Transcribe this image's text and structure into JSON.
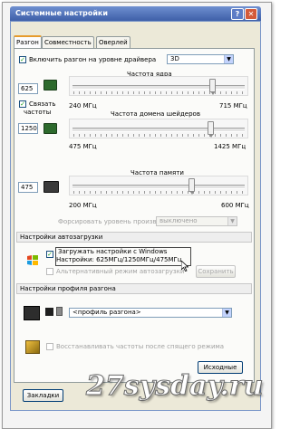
{
  "window": {
    "title": "Системные настройки"
  },
  "tabs": [
    {
      "label": "Разгон"
    },
    {
      "label": "Совместность"
    },
    {
      "label": "Оверлей"
    }
  ],
  "driver": {
    "enable_label": "Включить разгон на уровне драйвера",
    "enable_checked": true,
    "mode_value": "3D"
  },
  "core": {
    "title": "Частота ядра",
    "value": "625",
    "min_label": "240 МГц",
    "max_label": "715 МГц",
    "level": 0.81
  },
  "link": {
    "label_line1": "Связать",
    "label_line2": "частоты",
    "checked": true
  },
  "shader": {
    "title": "Частота домена шейдеров",
    "value": "1250",
    "min_label": "475 МГц",
    "max_label": "1425 МГц",
    "level": 0.8
  },
  "memory": {
    "title": "Частота памяти",
    "value": "475",
    "min_label": "200 МГц",
    "max_label": "600 МГц",
    "level": 0.69
  },
  "fan": {
    "label": "Форсировать уровень произв.",
    "select_value": "выключено"
  },
  "autoload": {
    "group_title": "Настройки автозагрузки",
    "load_line1": "Загружать настройки с Windows",
    "load_line2": "Настройки: 625МГц/1250МГц/475МГц",
    "load_checked": true,
    "alt_label": "Альтернативный режим автозагрузки",
    "save_button": "Сохранить"
  },
  "profile": {
    "group_title": "Настройки профиля разгона",
    "select_value": "<профиль разгона>"
  },
  "restore": {
    "label": "Восстанавливать частоты после спящего режима"
  },
  "buttons": {
    "defaults": "Исходные",
    "bookmarks": "Закладки"
  },
  "watermark": "27sysday.ru",
  "colors": {
    "title_bar": "#3e5fa8",
    "checkmark": "#21a121",
    "chip_green": "#2d6a2d",
    "chip_dark": "#3a3a3a"
  }
}
